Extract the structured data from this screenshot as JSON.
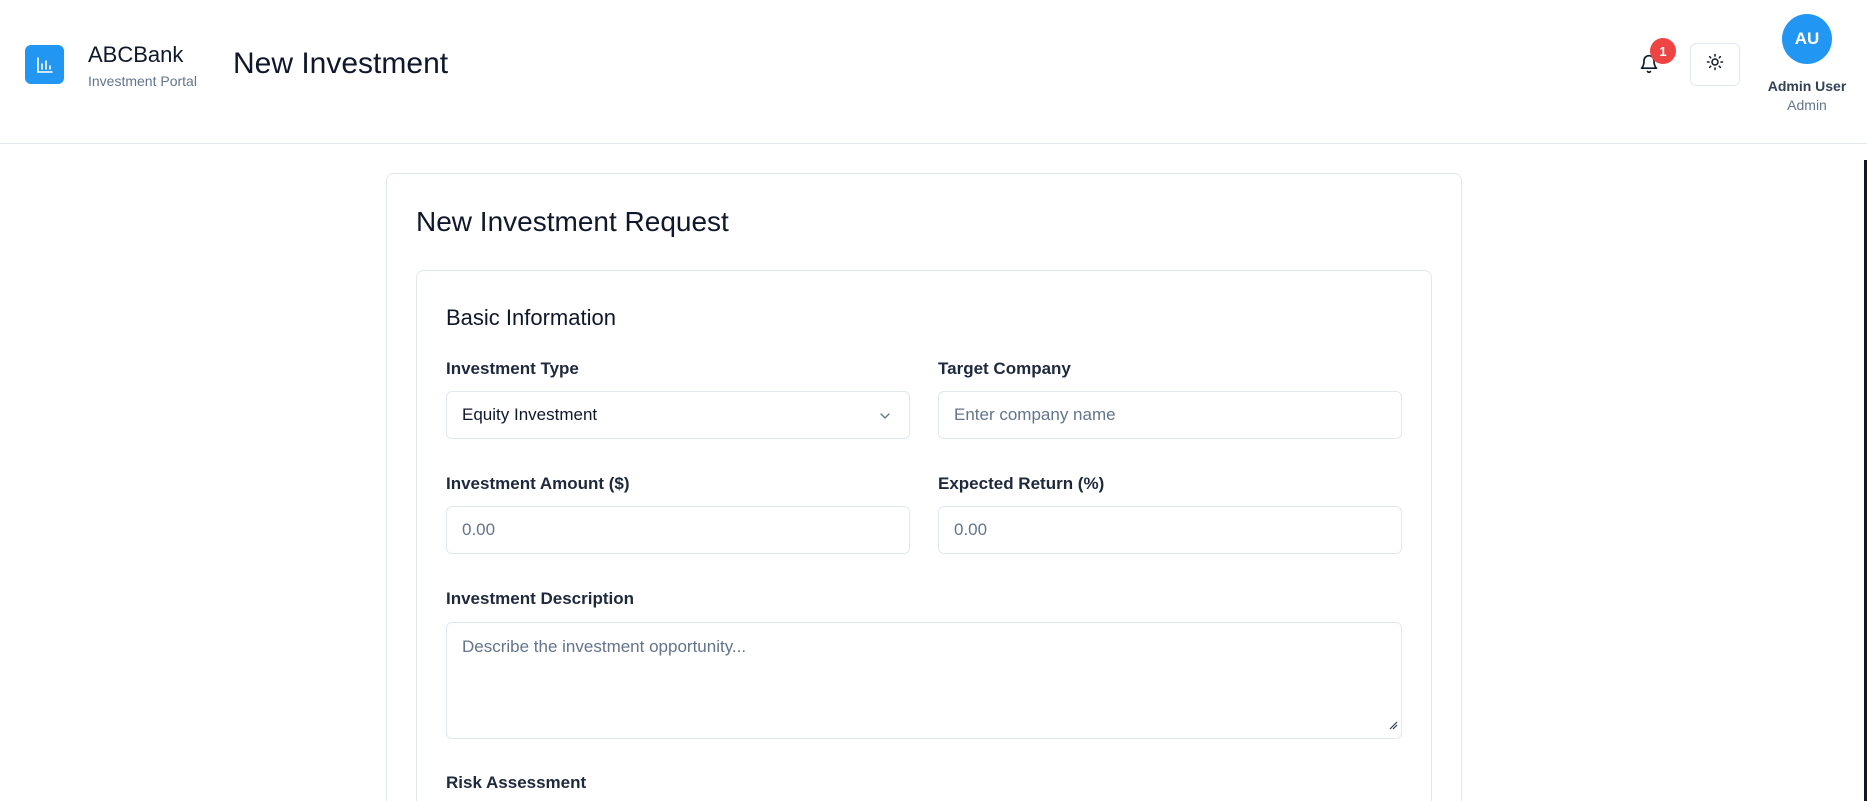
{
  "header": {
    "brand_name": "ABCBank",
    "brand_sub": "Investment Portal",
    "page_title": "New Investment",
    "notification_count": "1",
    "user": {
      "initials": "AU",
      "name": "Admin User",
      "role": "Admin"
    }
  },
  "form": {
    "title": "New Investment Request",
    "section_title": "Basic Information",
    "investment_type": {
      "label": "Investment Type",
      "value": "Equity Investment"
    },
    "target_company": {
      "label": "Target Company",
      "placeholder": "Enter company name"
    },
    "investment_amount": {
      "label": "Investment Amount ($)",
      "placeholder": "0.00"
    },
    "expected_return": {
      "label": "Expected Return (%)",
      "placeholder": "0.00"
    },
    "description": {
      "label": "Investment Description",
      "placeholder": "Describe the investment opportunity..."
    },
    "risk_assessment": {
      "label": "Risk Assessment"
    }
  },
  "colors": {
    "accent": "#2196f3",
    "badge": "#ef4444",
    "border": "#e2e8f0"
  },
  "icons": [
    "bar-chart-icon",
    "bell-icon",
    "sun-icon",
    "chevron-down-icon",
    "resize-grip-icon"
  ]
}
